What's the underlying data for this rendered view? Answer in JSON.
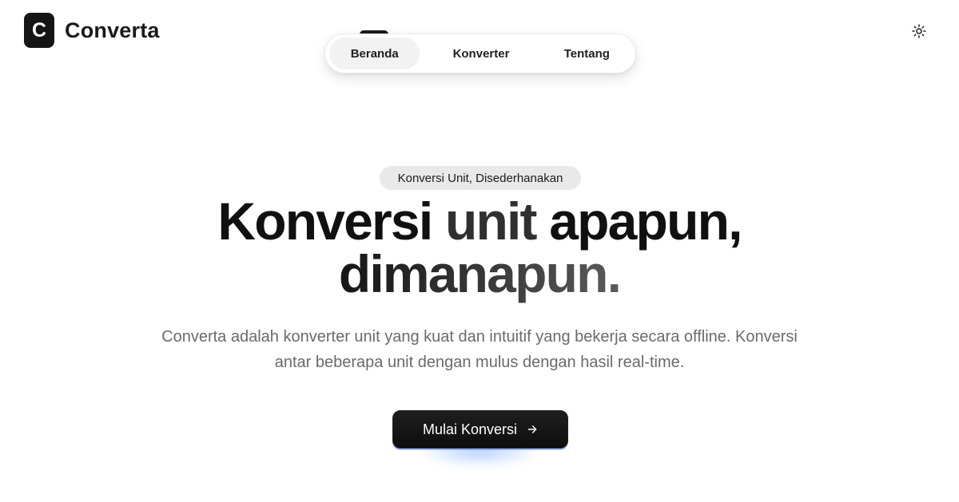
{
  "brand": {
    "logo_letter": "C",
    "name": "Converta"
  },
  "nav": {
    "items": [
      {
        "label": "Beranda",
        "active": true
      },
      {
        "label": "Konverter",
        "active": false
      },
      {
        "label": "Tentang",
        "active": false
      }
    ]
  },
  "theme_toggle": {
    "icon": "sun-icon"
  },
  "hero": {
    "badge": "Konversi Unit, Disederhanakan",
    "title_line1_a": "Konversi",
    "title_line1_b": "unit",
    "title_line1_c": "apapun,",
    "title_line2": "dimanapun.",
    "description": "Converta adalah konverter unit yang kuat dan intuitif yang bekerja secara offline. Konversi antar beberapa unit dengan mulus dengan hasil real-time."
  },
  "cta": {
    "label": "Mulai Konversi",
    "icon": "arrow-right-icon",
    "glow_color": "#5a8cff"
  }
}
